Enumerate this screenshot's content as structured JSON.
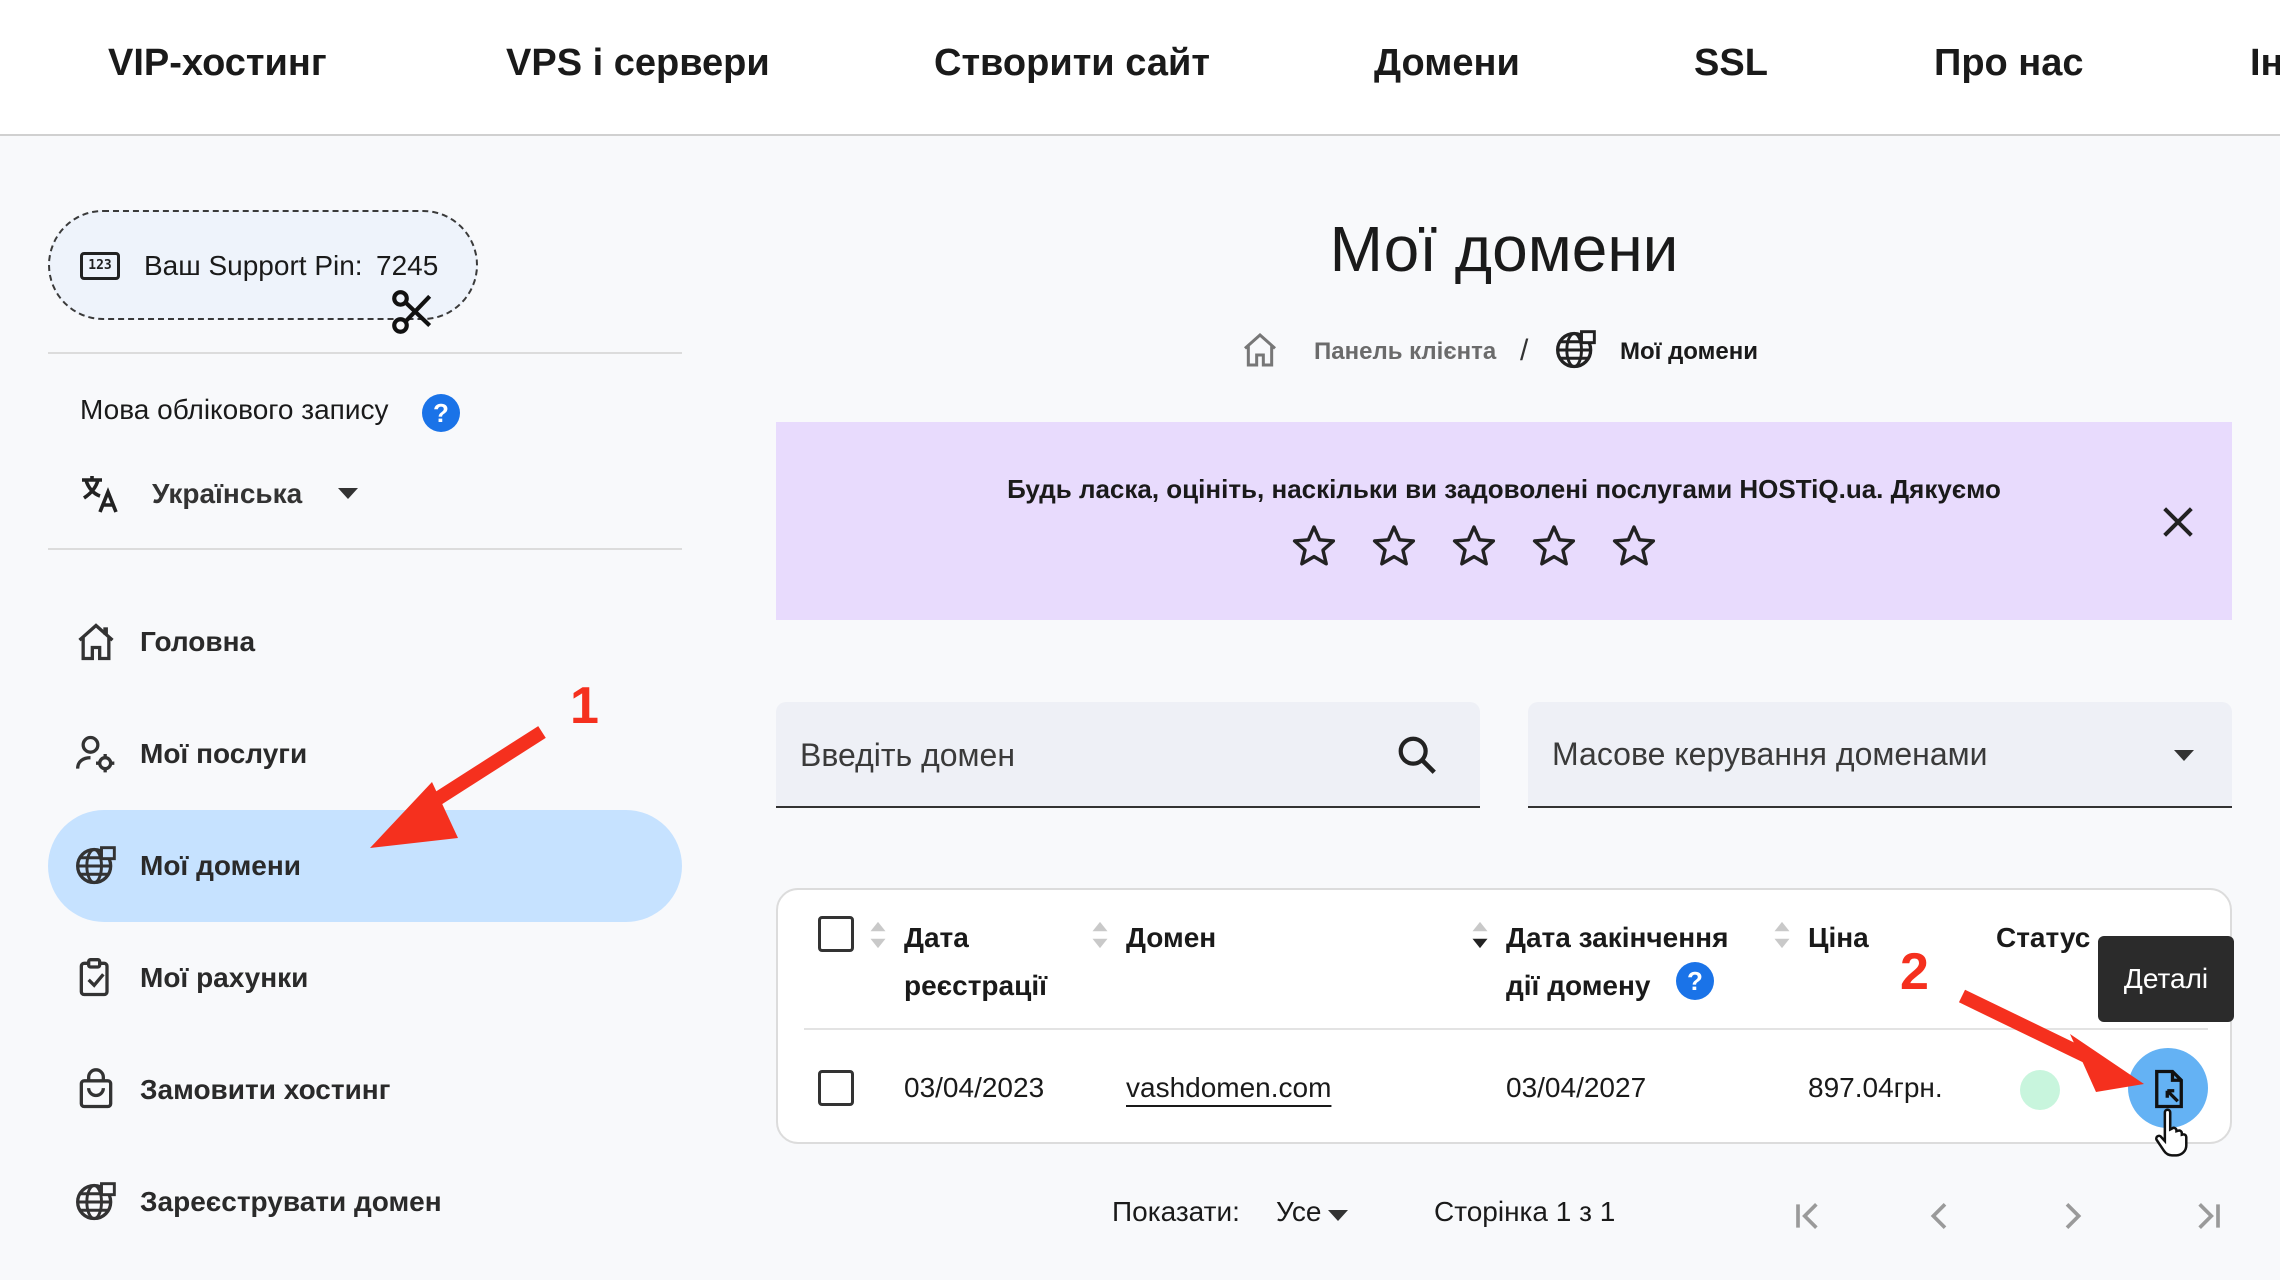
{
  "topnav": {
    "items": [
      "VIP-хостинг",
      "VPS і сервери",
      "Створити сайт",
      "Домени",
      "SSL",
      "Про нас",
      "Ін"
    ]
  },
  "sidebar": {
    "support_pin_label": "Ваш Support Pin:",
    "support_pin_value": "7245",
    "pin_icon_text": "123",
    "language_title": "Мова облікового запису",
    "help_mark": "?",
    "language_value": "Українська",
    "items": [
      {
        "label": "Головна",
        "icon": "home-icon"
      },
      {
        "label": "Мої послуги",
        "icon": "user-gear-icon"
      },
      {
        "label": "Мої домени",
        "icon": "globe-icon",
        "active": true
      },
      {
        "label": "Мої рахунки",
        "icon": "clipboard-check-icon"
      },
      {
        "label": "Замовити хостинг",
        "icon": "shopping-bag-icon"
      },
      {
        "label": "Зареєструвати домен",
        "icon": "globe-icon"
      }
    ]
  },
  "main": {
    "title": "Мої домени",
    "breadcrumb": {
      "home": "Панель клієнта",
      "separator": "/",
      "current": "Мої домени"
    },
    "rating": {
      "text": "Будь ласка, оцініть, наскільки ви задоволені послугами HOSTiQ.ua. Дякуємо",
      "stars": 5,
      "value": 0
    },
    "search": {
      "placeholder": "Введіть домен"
    },
    "bulk_select": {
      "label": "Масове керування доменами"
    },
    "table": {
      "headers": {
        "reg_date_1": "Дата",
        "reg_date_2": "реєстрації",
        "domain": "Домен",
        "exp_1": "Дата закінчення",
        "exp_2": "дії домену",
        "price": "Ціна",
        "status": "Статус"
      },
      "rows": [
        {
          "reg_date": "03/04/2023",
          "domain": "vashdomen.com",
          "exp_date": "03/04/2027",
          "price": "897.04грн.",
          "status_color": "#c8f5dd"
        }
      ]
    },
    "tooltip": "Деталі",
    "pager": {
      "show_label": "Показати:",
      "show_value": "Усе",
      "page_info": "Сторінка 1 з 1"
    }
  },
  "annotations": {
    "step1": "1",
    "step2": "2",
    "color": "#f5301e"
  }
}
